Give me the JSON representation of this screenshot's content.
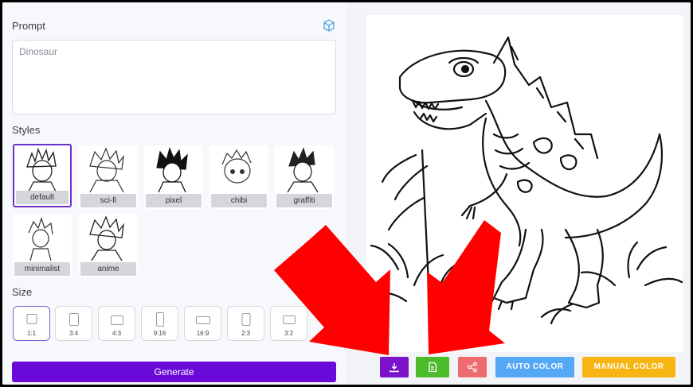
{
  "prompt": {
    "label": "Prompt",
    "value": "Dinosaur"
  },
  "styles": {
    "label": "Styles",
    "items": [
      {
        "label": "default",
        "selected": true
      },
      {
        "label": "sci-fi",
        "selected": false
      },
      {
        "label": "pixel",
        "selected": false
      },
      {
        "label": "chibi",
        "selected": false
      },
      {
        "label": "graffiti",
        "selected": false
      },
      {
        "label": "minimalist",
        "selected": false
      },
      {
        "label": "anime",
        "selected": false
      }
    ]
  },
  "size": {
    "label": "Size",
    "options": [
      "1:1",
      "3:4",
      "4:3",
      "9:16",
      "16:9",
      "2:3",
      "3:2"
    ],
    "selected": "1:1"
  },
  "generate_label": "Generate",
  "actions": {
    "download_icon": "download-icon",
    "save_icon": "file-save-icon",
    "share_icon": "share-icon",
    "auto_color_label": "AUTO COLOR",
    "manual_color_label": "MANUAL COLOR"
  },
  "colors": {
    "accent": "#6a0ad8",
    "download": "#7b12cc",
    "save": "#4cbb2c",
    "share": "#ee6b70",
    "auto_color": "#54a8f5",
    "manual_color": "#f7b514",
    "arrow": "#ff0000"
  }
}
